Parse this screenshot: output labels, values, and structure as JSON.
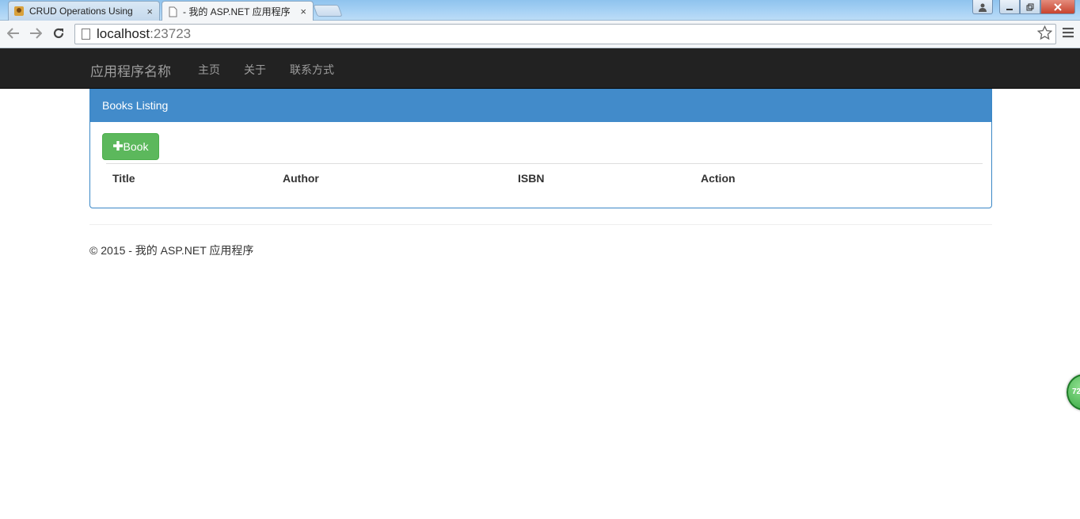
{
  "browser": {
    "tabs": [
      {
        "title": "CRUD Operations Using",
        "active": false
      },
      {
        "title": "- 我的 ASP.NET 应用程序",
        "active": true
      }
    ],
    "tab_close_glyph": "×",
    "url_host": "localhost",
    "url_port": ":23723"
  },
  "navbar": {
    "brand": "应用程序名称",
    "links": [
      "主页",
      "关于",
      "联系方式"
    ]
  },
  "panel": {
    "heading": "Books Listing",
    "add_button_label": "Book",
    "columns": [
      "Title",
      "Author",
      "ISBN",
      "Action"
    ]
  },
  "footer": {
    "text": "© 2015 - 我的 ASP.NET 应用程序"
  },
  "floating_widget": {
    "label": "72"
  },
  "colors": {
    "navbar_bg": "#222222",
    "panel_primary": "#428bca",
    "success_button": "#5cb85c"
  },
  "icons": [
    "tab-favicon-icon",
    "page-icon",
    "back-arrow-icon",
    "forward-arrow-icon",
    "reload-icon",
    "bookmark-star-icon",
    "chrome-menu-icon",
    "plus-icon"
  ]
}
